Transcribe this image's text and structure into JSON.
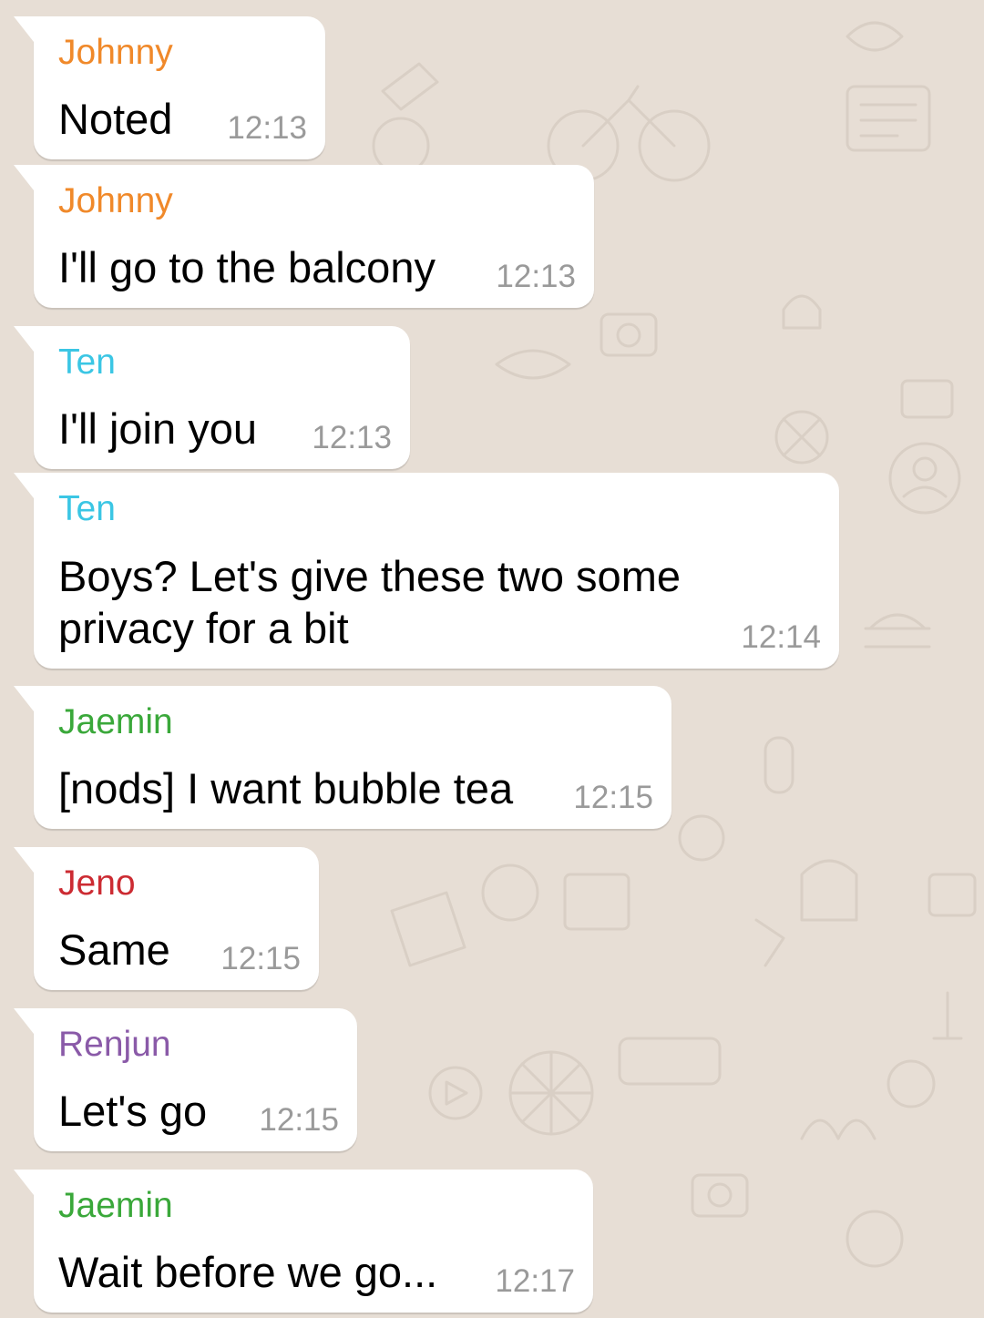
{
  "colors": {
    "background": "#e7ded5",
    "bubble": "#ffffff",
    "timestamp": "#9a9a9a",
    "sender_johnny": "#f0892a",
    "sender_ten": "#3bc6e4",
    "sender_jaemin": "#3aa83a",
    "sender_jeno": "#cc2b32",
    "sender_renjun": "#8a5aa8"
  },
  "messages": [
    {
      "sender": "Johnny",
      "text": "Noted",
      "time": "12:13"
    },
    {
      "sender": "Johnny",
      "text": "I'll go to the balcony",
      "time": "12:13"
    },
    {
      "sender": "Ten",
      "text": "I'll join you",
      "time": "12:13"
    },
    {
      "sender": "Ten",
      "text_line1": "Boys? Let's give these two some",
      "text_line2": "privacy for a bit",
      "time": "12:14"
    },
    {
      "sender": "Jaemin",
      "text": "[nods] I want bubble tea",
      "time": "12:15"
    },
    {
      "sender": "Jeno",
      "text": "Same",
      "time": "12:15"
    },
    {
      "sender": "Renjun",
      "text": "Let's go",
      "time": "12:15"
    },
    {
      "sender": "Jaemin",
      "text": "Wait before we go...",
      "time": "12:17"
    }
  ]
}
